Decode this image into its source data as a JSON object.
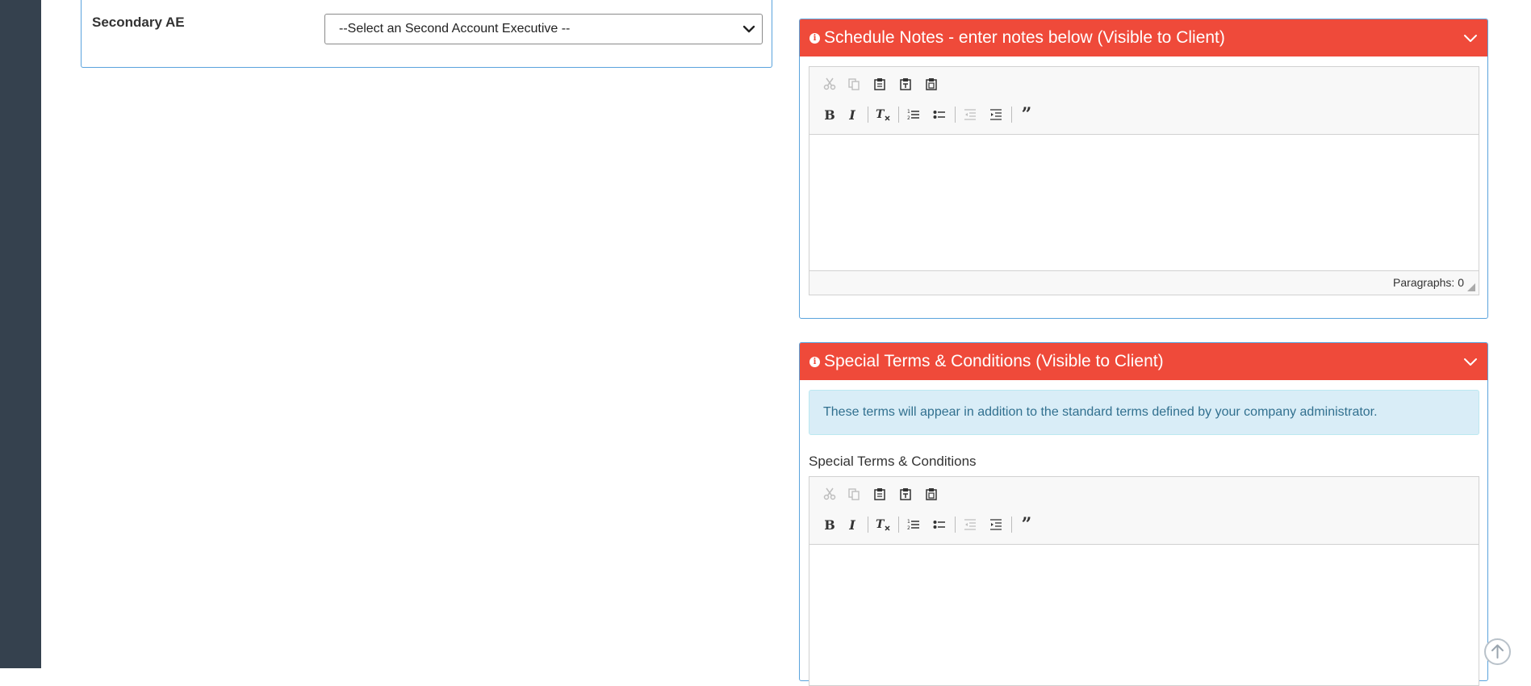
{
  "left_panel": {
    "secondary_ae_label": "Secondary AE",
    "secondary_ae_select": "--Select an Second Account Executive --"
  },
  "schedule_notes": {
    "title": "Schedule Notes - enter notes below (Visible to Client)",
    "paragraph_count": "Paragraphs: 0"
  },
  "special_terms": {
    "title": "Special Terms & Conditions (Visible to Client)",
    "info_text": "These terms will appear in addition to the standard terms defined by your company administrator.",
    "field_label": "Special Terms & Conditions"
  },
  "toolbar": {
    "row1": [
      "cut-icon",
      "copy-icon",
      "paste-icon",
      "paste-text-icon",
      "paste-word-icon"
    ],
    "row2": [
      "bold-icon",
      "italic-icon",
      "remove-format-icon",
      "numbered-list-icon",
      "bulleted-list-icon",
      "outdent-icon",
      "indent-icon",
      "blockquote-icon"
    ]
  },
  "colors": {
    "header_red": "#ef4a3a",
    "panel_border": "#5aa3dd",
    "rail": "#35414e",
    "alert_bg": "#d9edf7",
    "alert_text": "#31708f"
  }
}
